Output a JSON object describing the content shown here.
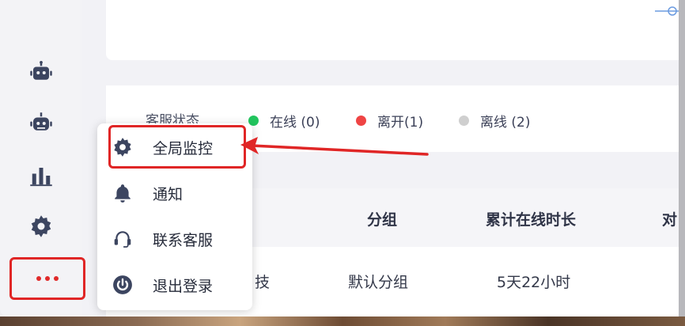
{
  "status": {
    "label": "客服状态",
    "items": [
      {
        "label": "在线 (0)",
        "color": "#22c55e"
      },
      {
        "label": "离开(1)",
        "color": "#ef4444"
      },
      {
        "label": "离线 (2)",
        "color": "#cfcfcf"
      }
    ]
  },
  "table": {
    "headers": [
      "分组",
      "累计在线时长",
      "对"
    ],
    "rows": [
      {
        "name_partial": "技",
        "group": "默认分组",
        "online_duration": "5天22小时"
      }
    ]
  },
  "menu": {
    "items": [
      {
        "label": "全局监控",
        "icon": "gear-icon"
      },
      {
        "label": "通知",
        "icon": "bell-icon"
      },
      {
        "label": "联系客服",
        "icon": "headset-icon"
      },
      {
        "label": "退出登录",
        "icon": "power-icon"
      }
    ]
  },
  "sidebar": {
    "icons": [
      "robot-icon",
      "robot-alt-icon",
      "bar-chart-icon",
      "settings-icon",
      "more-icon"
    ]
  },
  "annotation_colors": {
    "highlight": "#e02626"
  }
}
